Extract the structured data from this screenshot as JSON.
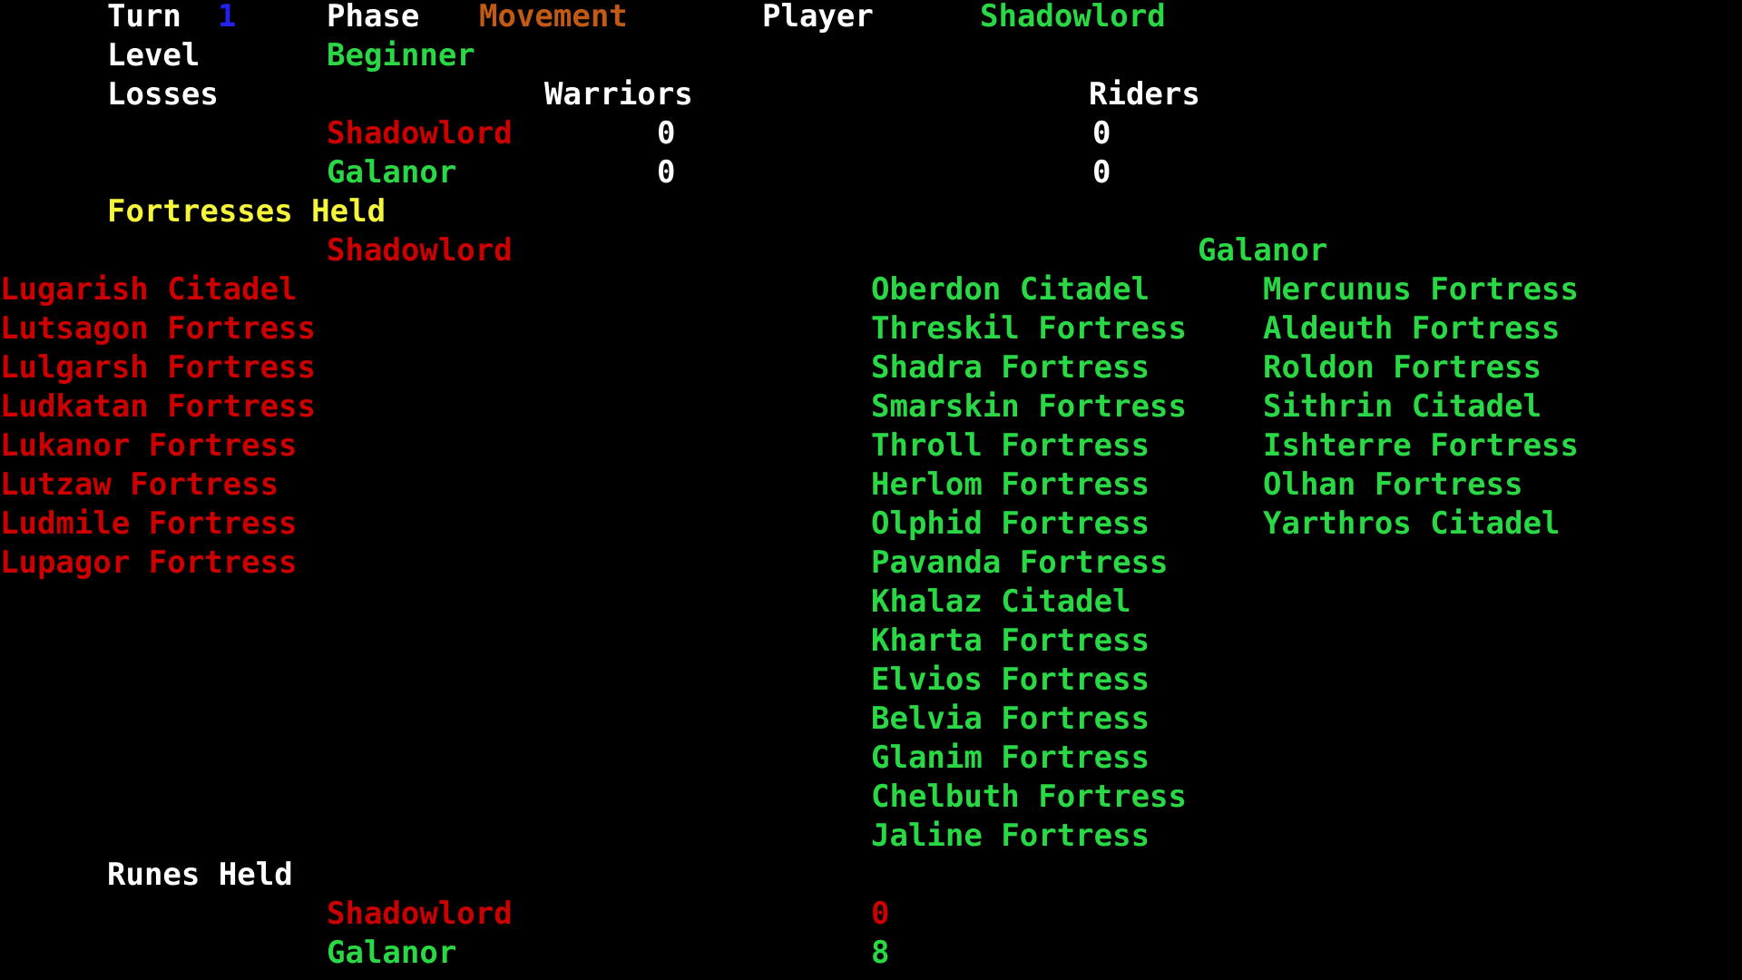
{
  "colors": {
    "background": "#000000",
    "white": "#ffffff",
    "turn_value": "#2222ee",
    "phase_value": "#c05a14",
    "galanor": "#2ad845",
    "shadowlord": "#cc0000",
    "section_heading": "#f5f53c"
  },
  "header": {
    "turn_label": "Turn",
    "turn_value": "1",
    "phase_label": "Phase",
    "phase_value": "Movement",
    "player_label": "Player",
    "player_value": "Shadowlord",
    "level_label": "Level",
    "level_value": "Beginner"
  },
  "losses": {
    "title": "Losses",
    "col_warriors": "Warriors",
    "col_riders": "Riders",
    "rows": [
      {
        "side": "Shadowlord",
        "warriors": "0",
        "riders": "0"
      },
      {
        "side": "Galanor",
        "warriors": "0",
        "riders": "0"
      }
    ]
  },
  "fortresses": {
    "title": "Fortresses Held",
    "shadowlord_header": "Shadowlord",
    "galanor_header": "Galanor",
    "shadowlord_list": [
      "Lugarish Citadel",
      "Lutsagon Fortress",
      "Lulgarsh Fortress",
      "Ludkatan Fortress",
      "Lukanor Fortress",
      "Lutzaw Fortress",
      "Ludmile Fortress",
      "Lupagor Fortress"
    ],
    "galanor_list_col1": [
      "Oberdon Citadel",
      "Threskil Fortress",
      "Shadra Fortress",
      "Smarskin Fortress",
      "Throll Fortress",
      "Herlom Fortress",
      "Olphid Fortress",
      "Pavanda Fortress",
      "Khalaz Citadel",
      "Kharta Fortress",
      "Elvios Fortress",
      "Belvia Fortress",
      "Glanim Fortress",
      "Chelbuth Fortress",
      "Jaline Fortress"
    ],
    "galanor_list_col2": [
      "Mercunus Fortress",
      "Aldeuth Fortress",
      "Roldon Fortress",
      "Sithrin Citadel",
      "Ishterre Fortress",
      "Olhan Fortress",
      "Yarthros Citadel"
    ]
  },
  "runes": {
    "title": "Runes Held",
    "rows": [
      {
        "side": "Shadowlord",
        "count": "0"
      },
      {
        "side": "Galanor",
        "count": "8"
      }
    ]
  }
}
